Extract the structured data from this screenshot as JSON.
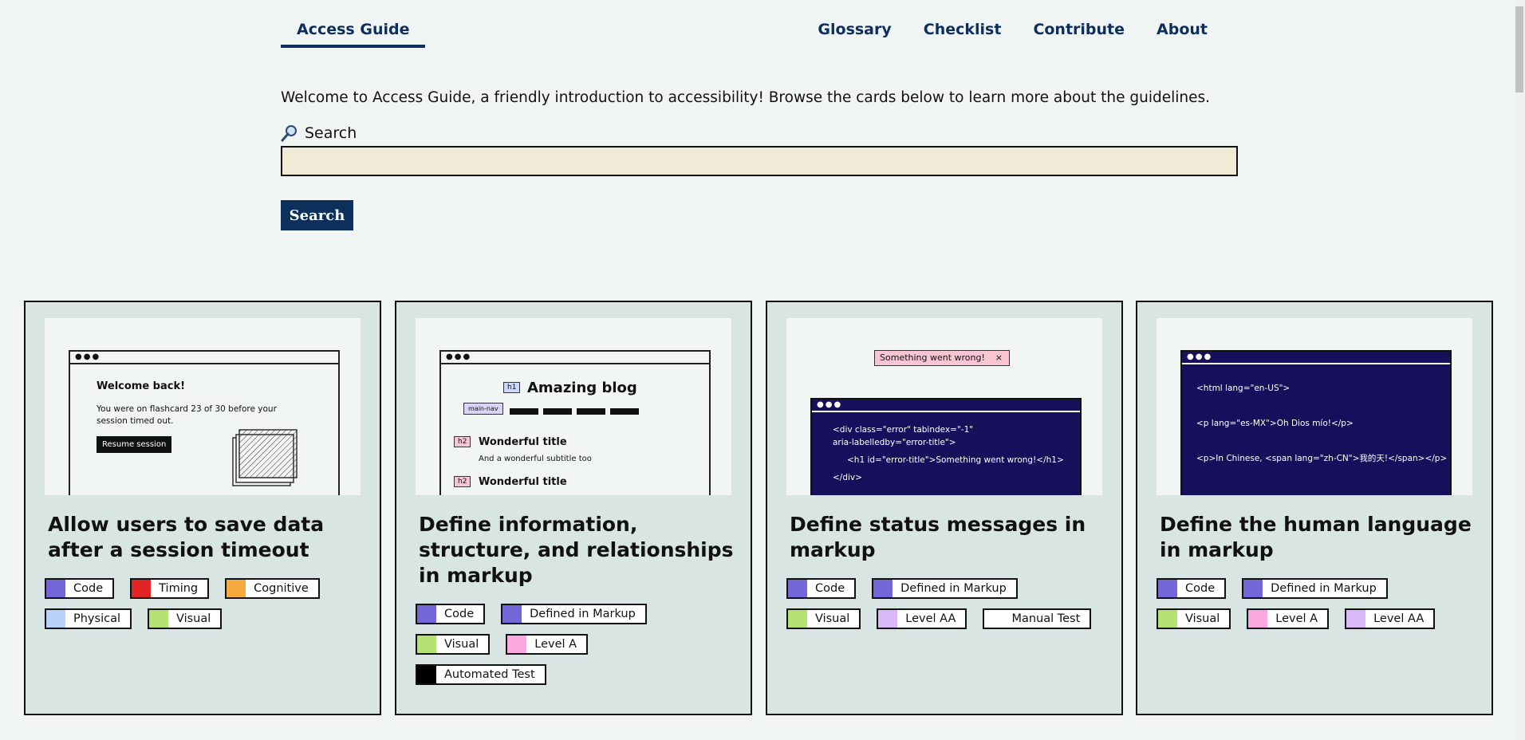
{
  "nav": {
    "brand": "Access Guide",
    "links": [
      "Glossary",
      "Checklist",
      "Contribute",
      "About"
    ]
  },
  "intro": "Welcome to Access Guide, a friendly introduction to accessibility! Browse the cards below to learn more about the guidelines.",
  "search": {
    "label": "Search",
    "value": "",
    "button": "Search"
  },
  "colors": {
    "navy": "#0d2f5c",
    "input_bg": "#f1ead7",
    "card_bg": "#d9e5e2",
    "code": "#7366d8",
    "timing": "#e02424",
    "cognitive": "#f4aa3c",
    "physical": "#b8d3fb",
    "visual": "#b5e373",
    "level_aa": "#d8b8f9",
    "level_a": "#fca8e0",
    "automated": "#000000",
    "manual": "#ffffff"
  },
  "cards": [
    {
      "title": "Allow users to save data after a session timeout",
      "illus": {
        "heading": "Welcome back!",
        "body1": "You were on flashcard 23 of 30 before your",
        "body2": "session timed out.",
        "button": "Resume session"
      },
      "tags": [
        {
          "label": "Code",
          "color": "#7366d8"
        },
        {
          "label": "Timing",
          "color": "#e02424"
        },
        {
          "label": "Cognitive",
          "color": "#f4aa3c"
        },
        {
          "label": "Physical",
          "color": "#b8d3fb"
        },
        {
          "label": "Visual",
          "color": "#b5e373"
        }
      ]
    },
    {
      "title": "Define information, structure, and relationships in markup",
      "illus": {
        "h1_badge": "h1",
        "h1": "Amazing blog",
        "nav_badge": "main-nav",
        "h2_badge": "h2",
        "h2a": "Wonderful title",
        "sub": "And a wonderful subtitle too",
        "h2b": "Wonderful title"
      },
      "tags": [
        {
          "label": "Code",
          "color": "#7366d8"
        },
        {
          "label": "Defined in Markup",
          "color": "#7366d8"
        },
        {
          "label": "Visual",
          "color": "#b5e373"
        },
        {
          "label": "Level A",
          "color": "#fca8e0"
        },
        {
          "label": "Automated Test",
          "color": "#000000"
        }
      ]
    },
    {
      "title": "Define status messages in markup",
      "illus": {
        "alert": "Something went wrong!",
        "close": "×",
        "line1": "<div class=\"error\" tabindex=\"-1\"",
        "line2": "aria-labelledby=\"error-title\">",
        "line3": "<h1 id=\"error-title\">Something went wrong!</h1>",
        "line4": "</div>"
      },
      "tags": [
        {
          "label": "Code",
          "color": "#7366d8"
        },
        {
          "label": "Defined in Markup",
          "color": "#7366d8"
        },
        {
          "label": "Visual",
          "color": "#b5e373"
        },
        {
          "label": "Level AA",
          "color": "#d8b8f9"
        },
        {
          "label": "Manual Test",
          "color": "#ffffff"
        }
      ]
    },
    {
      "title": "Define the human language in markup",
      "illus": {
        "line1": "<html lang=\"en-US\">",
        "line2": "<p lang=\"es-MX\">Oh Dios mío!</p>",
        "line3": "<p>In Chinese, <span lang=\"zh-CN\">我的天!</span></p>"
      },
      "tags": [
        {
          "label": "Code",
          "color": "#7366d8"
        },
        {
          "label": "Defined in Markup",
          "color": "#7366d8"
        },
        {
          "label": "Visual",
          "color": "#b5e373"
        },
        {
          "label": "Level A",
          "color": "#fca8e0"
        },
        {
          "label": "Level AA",
          "color": "#d8b8f9"
        }
      ]
    }
  ]
}
